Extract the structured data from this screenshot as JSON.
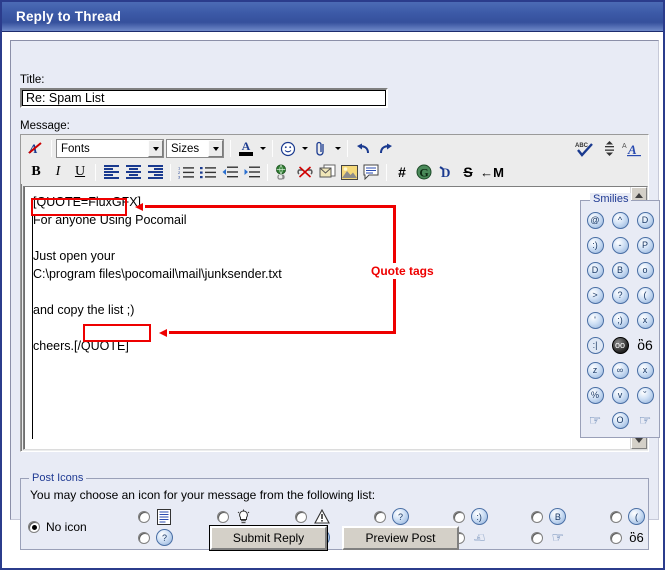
{
  "window": {
    "title": "Reply to Thread"
  },
  "form": {
    "title_label": "Title:",
    "title_value": "Re: Spam List",
    "title_placeholder": "",
    "message_label": "Message:"
  },
  "toolbar": {
    "fonts_select": "Fonts",
    "sizes_select": "Sizes",
    "row1": [
      {
        "name": "remove-formatting-icon",
        "glyph": "A̶"
      },
      {
        "name": "font-family-select",
        "glyph": "Fonts"
      },
      {
        "name": "font-size-select",
        "glyph": "Sizes"
      },
      {
        "name": "font-color-icon",
        "glyph": "A"
      },
      {
        "name": "smiley-insert-icon",
        "glyph": "☺"
      },
      {
        "name": "attachment-icon",
        "glyph": "⊘"
      },
      {
        "name": "undo-icon",
        "glyph": "↶"
      },
      {
        "name": "redo-icon",
        "glyph": "↷"
      },
      {
        "name": "spellcheck-icon",
        "glyph": "ABC"
      },
      {
        "name": "line-spacing-icon",
        "glyph": "↕"
      },
      {
        "name": "text-style-icon",
        "glyph": "A"
      }
    ],
    "row2": [
      {
        "name": "bold-button",
        "glyph": "B"
      },
      {
        "name": "italic-button",
        "glyph": "I"
      },
      {
        "name": "underline-button",
        "glyph": "U"
      },
      {
        "name": "align-left-button",
        "glyph": "≡"
      },
      {
        "name": "align-center-button",
        "glyph": "≡"
      },
      {
        "name": "align-right-button",
        "glyph": "≡"
      },
      {
        "name": "ordered-list-button",
        "glyph": "1."
      },
      {
        "name": "unordered-list-button",
        "glyph": "•"
      },
      {
        "name": "outdent-button",
        "glyph": "←≡"
      },
      {
        "name": "indent-button",
        "glyph": "→≡"
      },
      {
        "name": "insert-link-button",
        "glyph": "ἱ0"
      },
      {
        "name": "remove-link-button",
        "glyph": "✗"
      },
      {
        "name": "insert-email-button",
        "glyph": "✉"
      },
      {
        "name": "insert-image-button",
        "glyph": "ὛC"
      },
      {
        "name": "insert-quote-button",
        "glyph": "὞8"
      },
      {
        "name": "hash-button",
        "glyph": "#"
      },
      {
        "name": "g-button",
        "glyph": "G"
      },
      {
        "name": "d-button",
        "glyph": "D"
      },
      {
        "name": "s-button",
        "glyph": "S"
      },
      {
        "name": "m-button",
        "glyph": "←M"
      }
    ],
    "spellcheck_label": "ABC"
  },
  "message": {
    "lines": [
      "[QUOTE=FluxGFX]",
      "For anyone Using Pocomail",
      "",
      "Just open your",
      "C:\\program files\\pocomail\\mail\\junksender.txt",
      "",
      "and copy the list ;)",
      "",
      "cheers.[/QUOTE]"
    ],
    "full_text": "[QUOTE=FluxGFX]\nFor anyone Using Pocomail\n\nJust open your\nC:\\program files\\pocomail\\mail\\junksender.txt\n\nand copy the list ;)\n\ncheers.[/QUOTE]"
  },
  "annotation": {
    "label": "Quote tags",
    "color": "#ee0000",
    "targets": [
      "[QUOTE=FluxGFX]",
      "[/QUOTE]"
    ]
  },
  "smilies": {
    "legend": "Smilies",
    "items": [
      {
        "name": "smiley-dizzy",
        "glyph": "@",
        "style": "normal"
      },
      {
        "name": "smiley-wink-confused",
        "glyph": "^",
        "style": "normal"
      },
      {
        "name": "smiley-grin",
        "glyph": "D",
        "style": "normal"
      },
      {
        "name": "smiley-smile",
        "glyph": ":)",
        "style": "normal"
      },
      {
        "name": "smiley-neutral",
        "glyph": "-",
        "style": "normal"
      },
      {
        "name": "smiley-tongue",
        "glyph": "P",
        "style": "normal"
      },
      {
        "name": "smiley-big-grin",
        "glyph": "D",
        "style": "normal"
      },
      {
        "name": "smiley-cool",
        "glyph": "B",
        "style": "normal"
      },
      {
        "name": "smiley-blush",
        "glyph": "o",
        "style": "normal"
      },
      {
        "name": "smiley-angry",
        "glyph": ">",
        "style": "normal"
      },
      {
        "name": "smiley-confused-question",
        "glyph": "?",
        "style": "normal"
      },
      {
        "name": "smiley-sad",
        "glyph": "(",
        "style": "normal"
      },
      {
        "name": "smiley-cry",
        "glyph": "'",
        "style": "normal"
      },
      {
        "name": "smiley-wink",
        "glyph": ";)",
        "style": "normal"
      },
      {
        "name": "smiley-silent",
        "glyph": "x",
        "style": "normal"
      },
      {
        "name": "smiley-plain",
        "glyph": ":|",
        "style": "plain"
      },
      {
        "name": "smiley-sunglasses-dark",
        "glyph": "oo",
        "style": "dark"
      },
      {
        "name": "smiley-dog",
        "glyph": "ὃ6",
        "style": "dog"
      },
      {
        "name": "smiley-sleep",
        "glyph": "z",
        "style": "normal"
      },
      {
        "name": "smiley-no-mouth",
        "glyph": "∞",
        "style": "normal"
      },
      {
        "name": "smiley-cross-eyes",
        "glyph": "x",
        "style": "normal"
      },
      {
        "name": "smiley-sick",
        "glyph": "%",
        "style": "normal"
      },
      {
        "name": "smiley-devil",
        "glyph": "v",
        "style": "normal"
      },
      {
        "name": "smiley-roll-eyes",
        "glyph": "˘",
        "style": "normal"
      },
      {
        "name": "smiley-thumbs-up",
        "glyph": "ὄD",
        "style": "hand"
      },
      {
        "name": "smiley-surprised",
        "glyph": "O",
        "style": "normal"
      },
      {
        "name": "smiley-thumbs-down",
        "glyph": "ὄE",
        "style": "hand"
      }
    ]
  },
  "post_icons": {
    "legend": "Post Icons",
    "help_text": "You may choose an icon for your message from the following list:",
    "no_icon_label": "No icon",
    "no_icon_selected": true,
    "options": [
      {
        "name": "post-icon-document",
        "glyph": "Ὄ4",
        "row": 1,
        "col": 1
      },
      {
        "name": "post-icon-lightbulb",
        "glyph": "Ὂ1",
        "row": 1,
        "col": 2
      },
      {
        "name": "post-icon-warning",
        "glyph": "⚠",
        "row": 1,
        "col": 3
      },
      {
        "name": "post-icon-question",
        "glyph": "?",
        "row": 1,
        "col": 4
      },
      {
        "name": "post-icon-smile",
        "glyph": ":)",
        "row": 1,
        "col": 5
      },
      {
        "name": "post-icon-cool",
        "glyph": "B",
        "row": 1,
        "col": 6
      },
      {
        "name": "post-icon-sad",
        "glyph": "(",
        "row": 1,
        "col": 7
      },
      {
        "name": "post-icon-confused",
        "glyph": "?",
        "row": 2,
        "col": 1
      },
      {
        "name": "post-icon-grin",
        "glyph": "D",
        "row": 2,
        "col": 2
      },
      {
        "name": "post-icon-surprised",
        "glyph": "O",
        "row": 2,
        "col": 3
      },
      {
        "name": "post-icon-happy",
        "glyph": ":)",
        "row": 2,
        "col": 4
      },
      {
        "name": "post-icon-thumbs-down",
        "glyph": "ὄE",
        "row": 2,
        "col": 5
      },
      {
        "name": "post-icon-thumbs-up",
        "glyph": "ὄD",
        "row": 2,
        "col": 6
      },
      {
        "name": "post-icon-dog",
        "glyph": "ὃ6",
        "row": 2,
        "col": 7
      }
    ]
  },
  "actions": {
    "submit_label": "Submit Reply",
    "preview_label": "Preview Post"
  }
}
